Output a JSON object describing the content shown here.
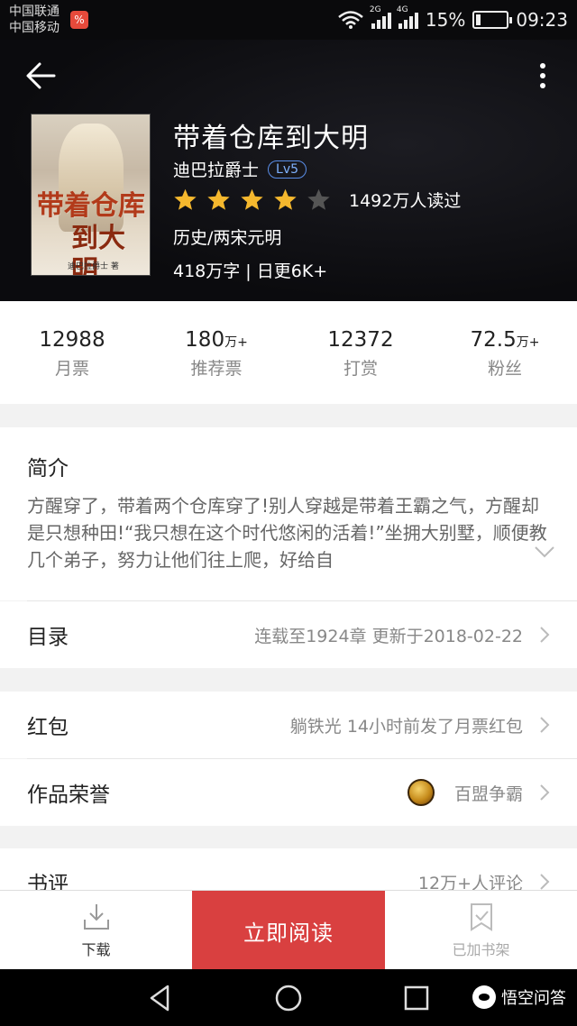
{
  "status_bar": {
    "carrier_1": "中国联通",
    "carrier_2": "中国移动",
    "signal_1_label": "2G",
    "signal_2_label": "4G",
    "battery": "15%",
    "battery_level": 0.15,
    "time": "09:23"
  },
  "book": {
    "title": "带着仓库到大明",
    "author": "迪巴拉爵士",
    "level": "Lv5",
    "rating_stars": 4,
    "rating_max": 5,
    "readers": "1492万人读过",
    "genre": "历史/两宋元明",
    "word_info": "418万字 | 日更6K+",
    "cover_title_line1": "带着仓库",
    "cover_title_line2": "到大明",
    "cover_author": "迪巴拉爵士 著"
  },
  "stats": [
    {
      "value": "12988",
      "unit": "",
      "label": "月票"
    },
    {
      "value": "180",
      "unit": "万+",
      "label": "推荐票"
    },
    {
      "value": "12372",
      "unit": "",
      "label": "打赏"
    },
    {
      "value": "72.5",
      "unit": "万+",
      "label": "粉丝"
    }
  ],
  "intro": {
    "title": "简介",
    "text": "方醒穿了，带着两个仓库穿了!别人穿越是带着王霸之气，方醒却是只想种田!“我只想在这个时代悠闲的活着!”坐拥大别墅，顺便教几个弟子，努力让他们往上爬，好给自"
  },
  "catalog": {
    "title": "目录",
    "value": "连载至1924章  更新于2018-02-22"
  },
  "red_packet": {
    "title": "红包",
    "value": "躺铁光  14小时前发了月票红包"
  },
  "honor": {
    "title": "作品荣誉",
    "value": "百盟争霸"
  },
  "review": {
    "title": "书评",
    "value": "12万+人评论"
  },
  "actions": {
    "download": "下载",
    "read": "立即阅读",
    "shelf": "已加书架"
  },
  "watermark": "悟空问答",
  "colors": {
    "primary_red": "#d94040",
    "star_gold": "#f5b82e",
    "level_blue": "#5a8ee8"
  }
}
